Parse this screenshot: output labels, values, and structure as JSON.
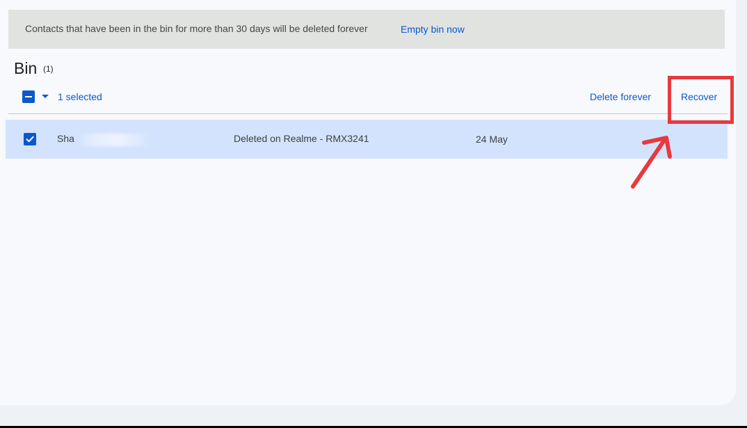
{
  "banner": {
    "message": "Contacts that have been in the bin for more than 30 days will be deleted forever",
    "action_label": "Empty bin now"
  },
  "bin": {
    "title": "Bin",
    "count": "(1)"
  },
  "toolbar": {
    "selected_label": "1 selected",
    "delete_label": "Delete forever",
    "recover_label": "Recover"
  },
  "rows": [
    {
      "name": "Sha",
      "source": "Deleted on Realme - RMX3241",
      "date": "24 May",
      "checked": true
    }
  ],
  "colors": {
    "accent": "#0b57d0",
    "selected_row": "#d3e3fd",
    "annotation": "#e8393d"
  }
}
